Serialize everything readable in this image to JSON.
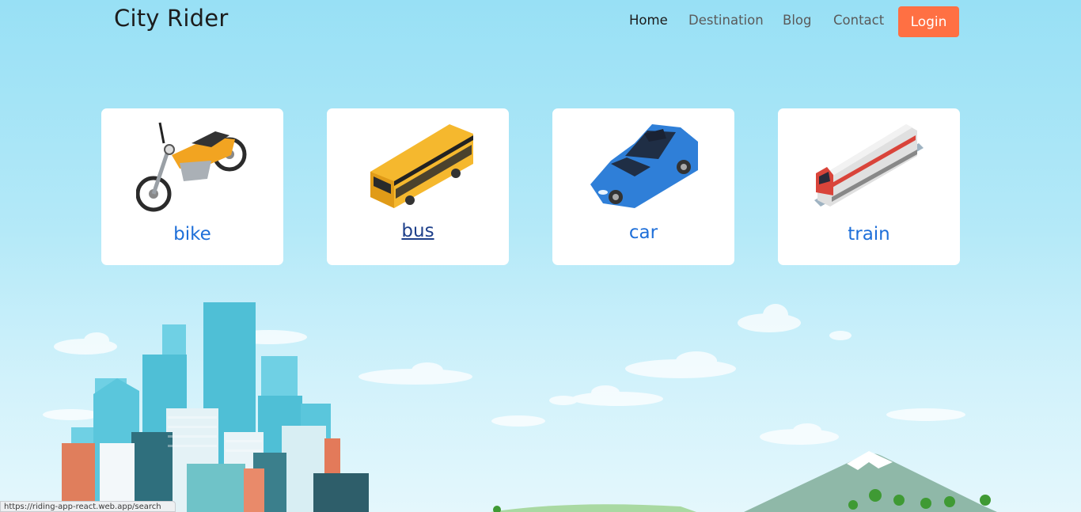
{
  "header": {
    "brand": "City Rider",
    "nav": [
      {
        "label": "Home"
      },
      {
        "label": "Destination"
      },
      {
        "label": "Blog"
      },
      {
        "label": "Contact"
      }
    ],
    "login_label": "Login",
    "accent": "#ff7043"
  },
  "cards": [
    {
      "label": "bike",
      "icon": "motorbike-icon"
    },
    {
      "label": "bus",
      "icon": "bus-icon"
    },
    {
      "label": "car",
      "icon": "car-icon"
    },
    {
      "label": "train",
      "icon": "train-icon"
    }
  ],
  "status_bar": {
    "url": "https://riding-app-react.web.app/search"
  },
  "colors": {
    "link": "#1e6fd9",
    "hovered_link": "#1d3f8a",
    "sky": "#98e0f5"
  }
}
